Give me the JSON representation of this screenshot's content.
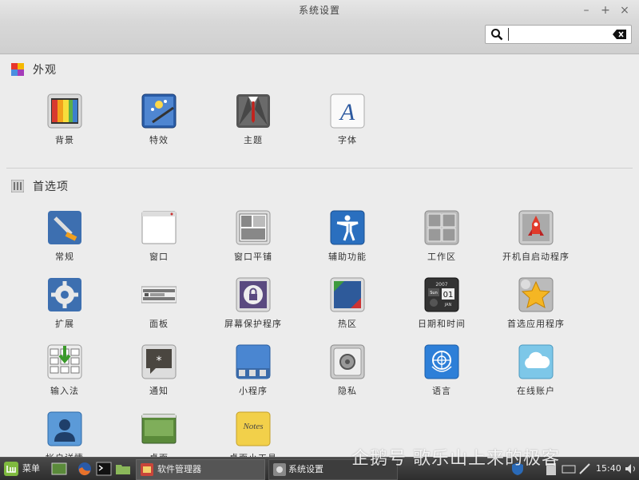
{
  "window": {
    "title": "系统设置"
  },
  "search": {
    "placeholder": "",
    "value": ""
  },
  "sections": {
    "appearance": {
      "title": "外观"
    },
    "preferences": {
      "title": "首选项"
    }
  },
  "appearance_items": [
    {
      "label": "背景",
      "icon": "backgrounds-icon"
    },
    {
      "label": "特效",
      "icon": "effects-icon"
    },
    {
      "label": "主题",
      "icon": "themes-icon"
    },
    {
      "label": "字体",
      "icon": "fonts-icon"
    }
  ],
  "preference_items": [
    {
      "label": "常规",
      "icon": "general-icon"
    },
    {
      "label": "窗口",
      "icon": "windows-icon"
    },
    {
      "label": "窗口平铺",
      "icon": "window-tiling-icon"
    },
    {
      "label": "辅助功能",
      "icon": "accessibility-icon"
    },
    {
      "label": "工作区",
      "icon": "workspaces-icon"
    },
    {
      "label": "开机自启动程序",
      "icon": "startup-apps-icon"
    },
    {
      "label": "扩展",
      "icon": "extensions-icon"
    },
    {
      "label": "面板",
      "icon": "panel-icon"
    },
    {
      "label": "屏幕保护程序",
      "icon": "screensaver-icon"
    },
    {
      "label": "热区",
      "icon": "hot-corners-icon"
    },
    {
      "label": "日期和时间",
      "icon": "date-time-icon"
    },
    {
      "label": "首选应用程序",
      "icon": "preferred-apps-icon"
    },
    {
      "label": "输入法",
      "icon": "input-method-icon"
    },
    {
      "label": "通知",
      "icon": "notifications-icon"
    },
    {
      "label": "小程序",
      "icon": "applets-icon"
    },
    {
      "label": "隐私",
      "icon": "privacy-icon"
    },
    {
      "label": "语言",
      "icon": "languages-icon"
    },
    {
      "label": "在线账户",
      "icon": "online-accounts-icon"
    },
    {
      "label": "帐户详情",
      "icon": "account-details-icon"
    },
    {
      "label": "桌面",
      "icon": "desktop-icon"
    },
    {
      "label": "桌面小工具",
      "icon": "desklets-icon"
    }
  ],
  "taskbar": {
    "menu_label": "菜单",
    "window1": "软件管理器",
    "window2": "系统设置",
    "clock": "15:40"
  },
  "watermark": "企鹅号 歌乐山上来的极客",
  "colors": {
    "taskbar_bg": "#3a3a3a",
    "window_bg": "#ececec",
    "mint_green": "#7fba3f"
  }
}
